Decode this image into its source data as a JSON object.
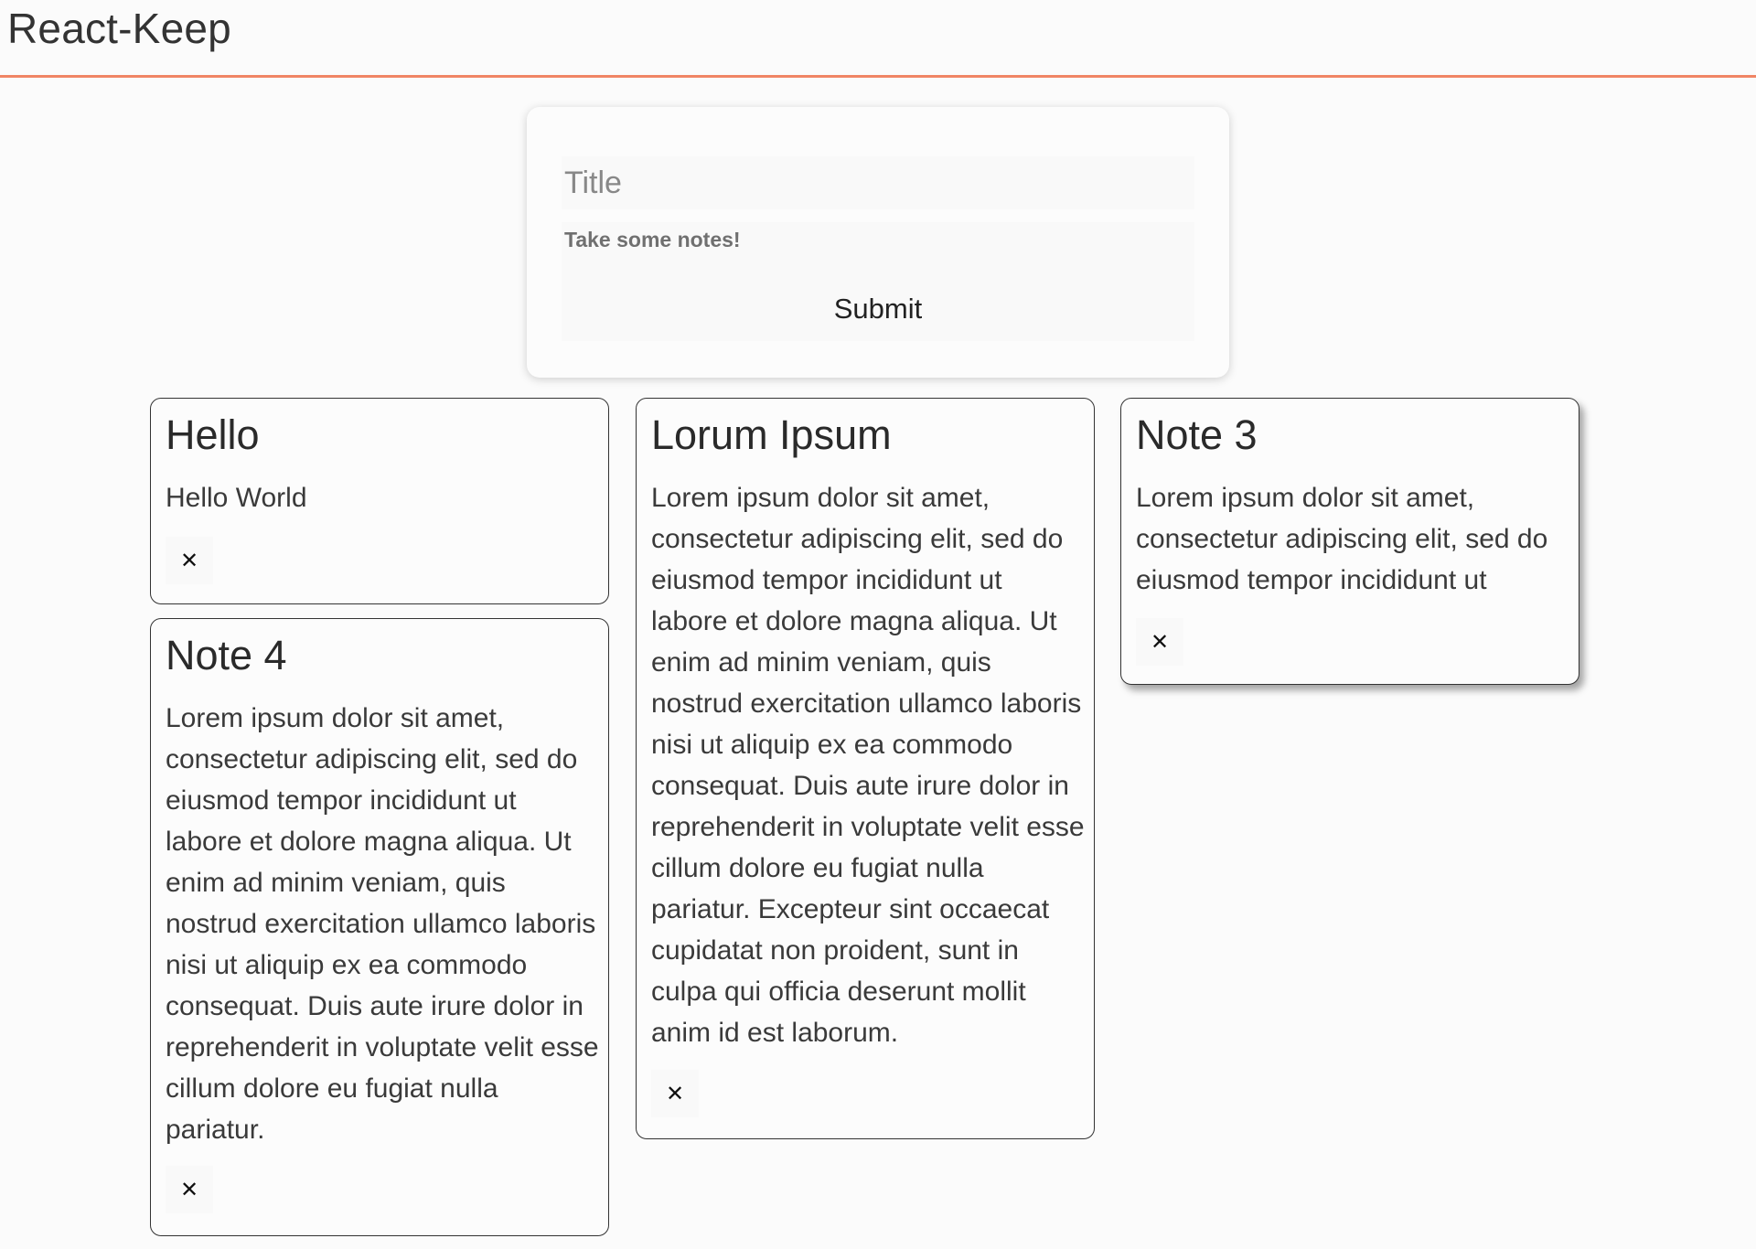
{
  "app": {
    "title": "React-Keep",
    "accent_color": "#f08565"
  },
  "compose": {
    "title_placeholder": "Title",
    "body_placeholder": "Take some notes!",
    "submit_label": "Submit"
  },
  "notes": [
    {
      "title": "Hello",
      "content": "Hello World",
      "delete_icon": "✕"
    },
    {
      "title": "Lorum Ipsum",
      "content": "Lorem ipsum dolor sit amet, consectetur adipiscing elit, sed do eiusmod tempor incididunt ut labore et dolore magna aliqua. Ut enim ad minim veniam, quis nostrud exercitation ullamco laboris nisi ut aliquip ex ea commodo consequat. Duis aute irure dolor in reprehenderit in voluptate velit esse cillum dolore eu fugiat nulla pariatur. Excepteur sint occaecat cupidatat non proident, sunt in culpa qui officia deserunt mollit anim id est laborum.",
      "delete_icon": "✕"
    },
    {
      "title": "Note 3",
      "content": "Lorem ipsum dolor sit amet, consectetur adipiscing elit, sed do eiusmod tempor incididunt ut",
      "delete_icon": "✕"
    },
    {
      "title": "Note 4",
      "content": "Lorem ipsum dolor sit amet, consectetur adipiscing elit, sed do eiusmod tempor incididunt ut labore et dolore magna aliqua. Ut enim ad minim veniam, quis nostrud exercitation ullamco laboris nisi ut aliquip ex ea commodo consequat. Duis aute irure dolor in reprehenderit in voluptate velit esse cillum dolore eu fugiat nulla pariatur.",
      "delete_icon": "✕"
    }
  ]
}
